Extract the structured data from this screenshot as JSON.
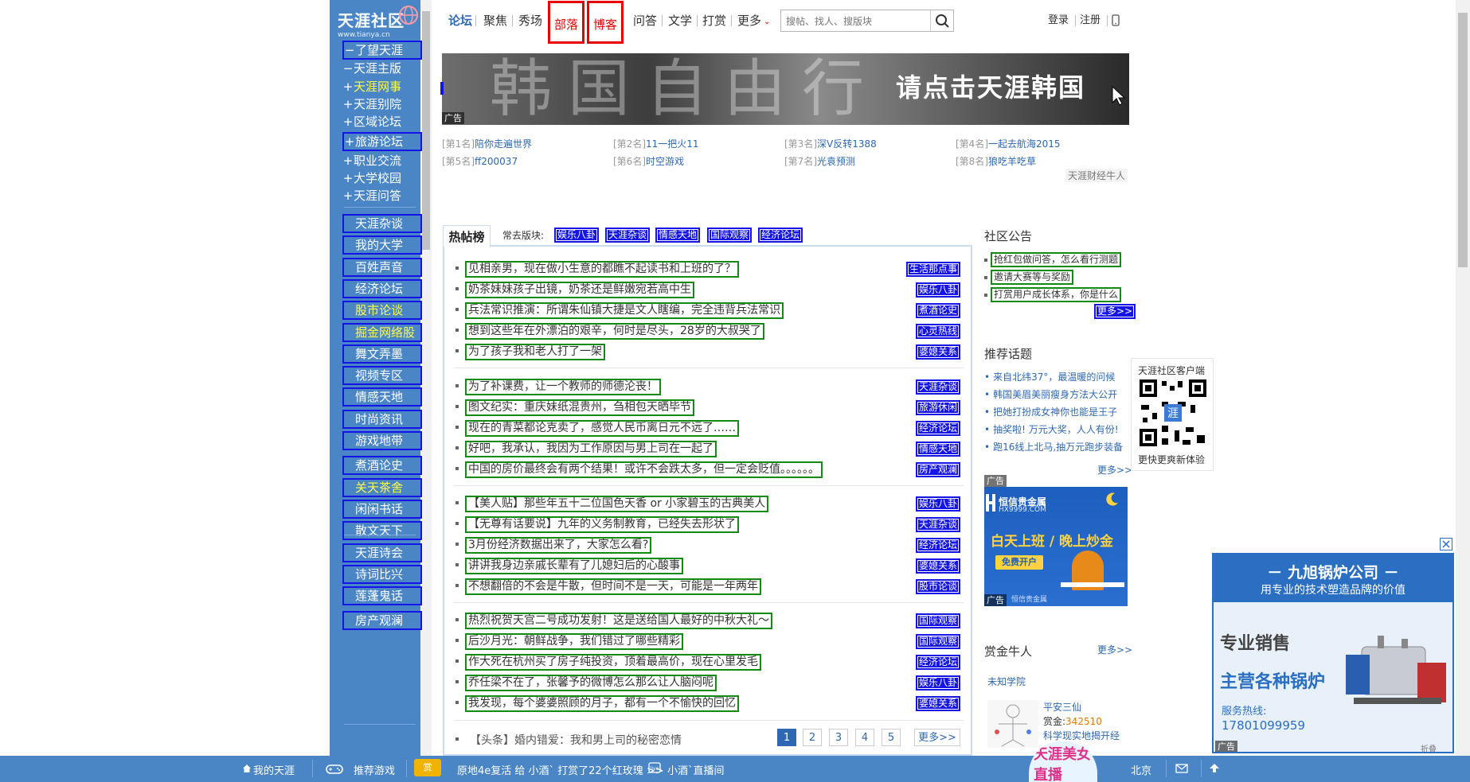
{
  "logo": {
    "text": "天涯社区",
    "url_text": "www.tianya.cn"
  },
  "sidebar": {
    "items": [
      {
        "pm": "−",
        "label": "了望天涯",
        "box": true,
        "yellow": false
      },
      {
        "pm": "−",
        "label": "天涯主版",
        "box": false,
        "yellow": false
      },
      {
        "pm": "+",
        "label": "天涯网事",
        "box": false,
        "yellow": true
      },
      {
        "pm": "+",
        "label": "天涯别院",
        "box": false,
        "yellow": false
      },
      {
        "pm": "+",
        "label": "区域论坛",
        "box": false,
        "yellow": false
      },
      {
        "pm": "+",
        "label": "旅游论坛",
        "box": true,
        "yellow": false
      },
      {
        "pm": "+",
        "label": "职业交流",
        "box": false,
        "yellow": false
      },
      {
        "pm": "+",
        "label": "大学校园",
        "box": false,
        "yellow": false
      },
      {
        "pm": "+",
        "label": "天涯问答",
        "box": false,
        "yellow": false
      }
    ],
    "boards": [
      {
        "label": "天涯杂谈",
        "yellow": false
      },
      {
        "label": "我的大学",
        "yellow": false
      },
      {
        "label": "百姓声音",
        "yellow": false
      },
      {
        "label": "经济论坛",
        "yellow": false
      },
      {
        "label": "股市论谈",
        "yellow": true
      },
      {
        "label": "掘金网络股",
        "yellow": true
      },
      {
        "label": "舞文弄墨",
        "yellow": false
      },
      {
        "label": "视频专区",
        "yellow": false
      },
      {
        "label": "情感天地",
        "yellow": false
      },
      {
        "label": "时尚资讯",
        "yellow": false
      },
      {
        "label": "游戏地带",
        "yellow": false
      },
      {
        "label": "煮酒论史",
        "yellow": false
      },
      {
        "label": "关天茶舍",
        "yellow": true
      },
      {
        "label": "闲闲书话",
        "yellow": false
      },
      {
        "label": "散文天下",
        "yellow": false
      },
      {
        "label": "天涯诗会",
        "yellow": false
      },
      {
        "label": "诗词比兴",
        "yellow": false
      },
      {
        "label": "莲蓬鬼话",
        "yellow": false
      },
      {
        "label": "房产观澜",
        "yellow": false
      }
    ]
  },
  "nav": {
    "items": [
      "论坛",
      "聚焦",
      "秀场",
      "部落",
      "博客",
      "问答",
      "文学",
      "打赏",
      "更多"
    ],
    "search_placeholder": "搜帖、找人、搜版块",
    "login": "登录",
    "register": "注册"
  },
  "banner": {
    "title_art": "韩国自由行",
    "cta": "请点击天涯韩国",
    "ad_label": "广告"
  },
  "ranks": [
    {
      "rank": "[第1名]",
      "name": "陪你走遍世界"
    },
    {
      "rank": "[第2名]",
      "name": "11一把火11"
    },
    {
      "rank": "[第3名]",
      "name": "深V反转1388"
    },
    {
      "rank": "[第4名]",
      "name": "一起去航海2015"
    },
    {
      "rank": "[第5名]",
      "name": "ff200037"
    },
    {
      "rank": "[第6名]",
      "name": "时空游戏"
    },
    {
      "rank": "[第7名]",
      "name": "光袁预测"
    },
    {
      "rank": "[第8名]",
      "name": "狼吃羊吃草"
    }
  ],
  "rank_footer": "天涯财经牛人",
  "hot": {
    "tab_label": "热帖榜",
    "frequent_label": "常去版块:",
    "frequent": [
      "娱乐八卦",
      "天涯杂谈",
      "情感天地",
      "国际观察",
      "经济论坛"
    ],
    "posts": [
      {
        "title": "见相亲男，现在做小生意的都瞧不起读书和上班的了？",
        "tag": "生活那点事"
      },
      {
        "title": "奶茶妹妹孩子出镜，奶茶还是鲜嫩宛若高中生",
        "tag": "娱乐八卦"
      },
      {
        "title": "兵法常识推演：所谓朱仙镇大捷是文人瞎编，完全违背兵法常识",
        "tag": "煮酒论史"
      },
      {
        "title": "想到这些年在外漂泊的艰辛，何时是尽头，28岁的大叔哭了",
        "tag": "心灵热线"
      },
      {
        "title": "为了孩子我和老人打了一架",
        "tag": "婆媳关系"
      },
      {
        "title": "为了补课费，让一个教师的师德沦丧！",
        "tag": "天涯杂谈"
      },
      {
        "title": "图文纪实：重庆妹纸混贵州，刍相包天晒毕节",
        "tag": "旅游休闲"
      },
      {
        "title": "现在的青菜都论克卖了，感觉人民币离日元不远了……",
        "tag": "经济论坛"
      },
      {
        "title": "好吧，我承认，我因为工作原因与男上司在一起了",
        "tag": "情感天地"
      },
      {
        "title": "中国的房价最终会有两个结果！或许不会跌太多，但一定会贬值。。。。。。",
        "tag": "房产观澜"
      },
      {
        "title": "【美人贴】那些年五十二位国色天香 or 小家碧玉的古典美人",
        "tag": "娱乐八卦"
      },
      {
        "title": "【无尊有话要说】九年的义务制教育，已经失去形状了",
        "tag": "天涯杂谈"
      },
      {
        "title": "3月份经济数据出来了，大家怎么看?",
        "tag": "经济论坛"
      },
      {
        "title": "讲讲我身边亲戚长辈有了儿媳妇后的心酸事",
        "tag": "婆媳关系"
      },
      {
        "title": "不想翻倍的不会是牛散，但时间不是一天，可能是一年两年",
        "tag": "股市论谈"
      },
      {
        "title": "热烈祝贺天宫二号成功发射！这是送给国人最好的中秋大礼～",
        "tag": "国际观察"
      },
      {
        "title": "后沙月光：朝鲜战争，我们错过了哪些精彩",
        "tag": "国际观察"
      },
      {
        "title": "作大死在杭州买了房子纯投资，顶着最高价，现在心里发毛",
        "tag": "经济论坛"
      },
      {
        "title": "乔任梁不在了，张馨予的微博怎么那么让人脑闷呢",
        "tag": "娱乐八卦"
      },
      {
        "title": "我发现，每个婆婆照顾的月子，都有一个不愉快的回忆",
        "tag": "婆媳关系"
      }
    ],
    "headline": "【头条】婚内错爱：我和男上司的秘密恋情",
    "pages": [
      "1",
      "2",
      "3",
      "4",
      "5"
    ],
    "more": "更多>>"
  },
  "notice": {
    "title": "社区公告",
    "items": [
      "抢红包做问答，怎么看行测题",
      "邀请大赛等与奖励",
      "打赏用户成长体系，你是什么"
    ],
    "more": "更多>>"
  },
  "topics": {
    "title": "推荐话题",
    "items": [
      "来自北纬37°，最温暖的问候",
      "韩国美眉美丽瘦身方法大公开",
      "把她打扮成女神你也能是王子",
      "抽奖啦! 万元大奖，人人有份!",
      "跑16线上北马,抽万元跑步装备"
    ],
    "more": "更多>>"
  },
  "qr": {
    "title": "天涯社区客户端",
    "caption": "更快更爽新体验",
    "center": "涯"
  },
  "side_ad": {
    "label": "广告",
    "brand": "恒信贵金属",
    "site": "HX9999.COM",
    "slogan": "白天上班 / 晚上炒金",
    "button": "免费开户",
    "footer": "恒信贵金属"
  },
  "bounty": {
    "title": "赏金牛人",
    "more": "更多>>",
    "school": "未知学院",
    "user": "平安三仙",
    "amount_label": "赏金:",
    "amount": "342510",
    "desc": "科学现实地揭开经"
  },
  "float_ad": {
    "title": "－ 九旭锅炉公司 －",
    "subtitle": "用专业的技术塑造品牌的价值",
    "line1": "专业销售",
    "line2": "主营各种锅炉",
    "hotline_label": "服务热线:",
    "phone": "17801099959",
    "ad_label": "广告",
    "fold": "折叠"
  },
  "bottom": {
    "my": "我的天涯",
    "games": "推荐游戏",
    "ticker": "原地4e复活 给 小酒` 打赏了22个红玫瑰 >> ",
    "live_user": "小酒`直播间",
    "live_promo": "天涯美女直播",
    "city": "北京"
  }
}
